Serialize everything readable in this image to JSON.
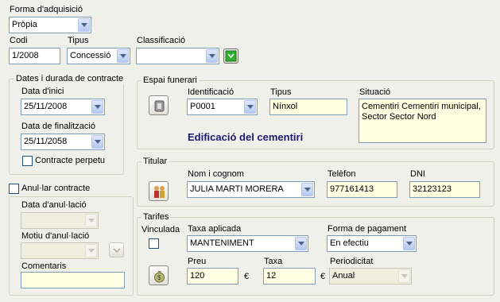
{
  "forma_adquisicio": {
    "label": "Forma d'adquisició",
    "value": "Pròpia"
  },
  "codi": {
    "label": "Codi",
    "value": "1/2008"
  },
  "tipus": {
    "label": "Tipus",
    "value": "Concessió"
  },
  "classificacio": {
    "label": "Classificació",
    "value": ""
  },
  "dates_group": {
    "title": "Dates i durada de contracte",
    "data_inici": {
      "label": "Data d'inici",
      "value": "25/11/2008"
    },
    "data_final": {
      "label": "Data de finalització",
      "value": "25/11/2058"
    },
    "perpetu": {
      "label": "Contracte perpetu",
      "checked": false
    }
  },
  "anullar": {
    "label": "Anul·lar contracte",
    "checked": false,
    "data_label": "Data d'anul·lació",
    "data_value": "",
    "motiu_label": "Motiu d'anul·lació",
    "motiu_value": "",
    "comentaris_label": "Comentaris",
    "comentaris_value": ""
  },
  "espai": {
    "title": "Espai funerari",
    "identificacio": {
      "label": "Identificació",
      "value": "P0001"
    },
    "tipus": {
      "label": "Tipus",
      "value": "Nínxol"
    },
    "situacio": {
      "label": "Situació",
      "value": "Cementiri Cementiri municipal, Sector Sector Nord"
    },
    "edificacio": "Edificació del cementiri"
  },
  "titular": {
    "title": "Titular",
    "nom": {
      "label": "Nom i cognom",
      "value": "JULIA MARTI MORERA"
    },
    "telefon": {
      "label": "Telèfon",
      "value": "977161413"
    },
    "dni": {
      "label": "DNI",
      "value": "32123123"
    }
  },
  "tarifes": {
    "title": "Tarifes",
    "vinculada": {
      "label": "Vinculada",
      "checked": false
    },
    "taxa_aplicada": {
      "label": "Taxa aplicada",
      "value": "MANTENIMENT"
    },
    "forma_pagament": {
      "label": "Forma de pagament",
      "value": "En efectiu"
    },
    "preu": {
      "label": "Preu",
      "value": "120",
      "currency": "€"
    },
    "taxa": {
      "label": "Taxa",
      "value": "12",
      "currency": "€"
    },
    "periodicitat": {
      "label": "Periodicitat",
      "value": "Anual"
    }
  },
  "icons": {
    "classificacio_button": "green-checkbox-icon",
    "espai_button": "niche-icon",
    "titular_button": "people-icon",
    "tarifes_button": "money-bag-icon",
    "motiu_button": "dropdown-icon"
  },
  "colors": {
    "accent_green": "#2fae2f",
    "title_blue": "#1a1a6e",
    "field_yellow": "#ffffe1"
  }
}
